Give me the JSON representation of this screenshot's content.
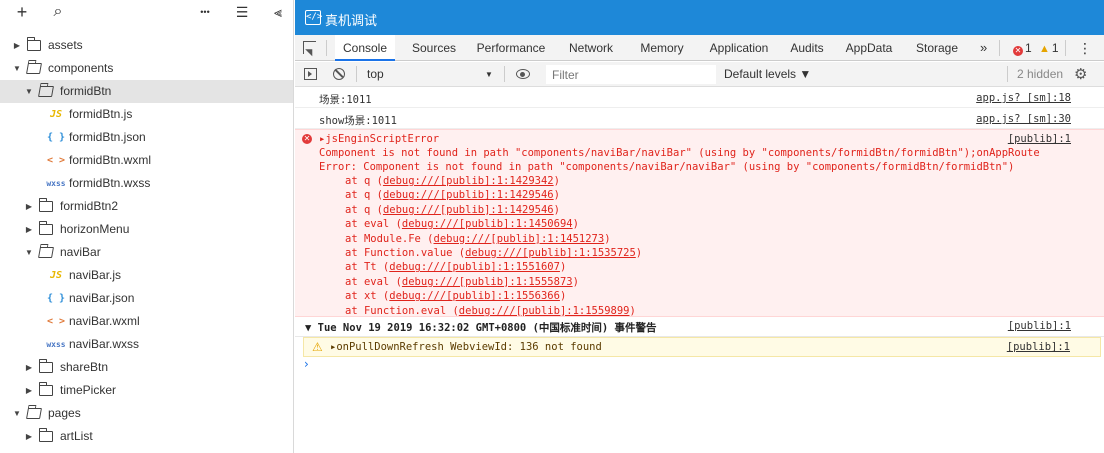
{
  "explorer": {
    "toolbar": {
      "add": "+",
      "search": "⌕",
      "more": "•••",
      "collapse": "☰",
      "split": "⫷"
    },
    "tree": [
      {
        "label": "assets",
        "type": "folder",
        "open": false,
        "depth": 0
      },
      {
        "label": "components",
        "type": "folder",
        "open": true,
        "depth": 0
      },
      {
        "label": "formidBtn",
        "type": "folder",
        "open": true,
        "depth": 1,
        "selected": true
      },
      {
        "label": "formidBtn.js",
        "type": "js",
        "icon": "JS",
        "depth": 2
      },
      {
        "label": "formidBtn.json",
        "type": "json",
        "icon": "{ }",
        "depth": 2
      },
      {
        "label": "formidBtn.wxml",
        "type": "wxml",
        "icon": "< >",
        "depth": 2
      },
      {
        "label": "formidBtn.wxss",
        "type": "wxss",
        "icon": "wxss",
        "depth": 2
      },
      {
        "label": "formidBtn2",
        "type": "folder",
        "open": false,
        "depth": 1
      },
      {
        "label": "horizonMenu",
        "type": "folder",
        "open": false,
        "depth": 1
      },
      {
        "label": "naviBar",
        "type": "folder",
        "open": true,
        "depth": 1
      },
      {
        "label": "naviBar.js",
        "type": "js",
        "icon": "JS",
        "depth": 2
      },
      {
        "label": "naviBar.json",
        "type": "json",
        "icon": "{ }",
        "depth": 2
      },
      {
        "label": "naviBar.wxml",
        "type": "wxml",
        "icon": "< >",
        "depth": 2
      },
      {
        "label": "naviBar.wxss",
        "type": "wxss",
        "icon": "wxss",
        "depth": 2
      },
      {
        "label": "shareBtn",
        "type": "folder",
        "open": false,
        "depth": 1
      },
      {
        "label": "timePicker",
        "type": "folder",
        "open": false,
        "depth": 1
      },
      {
        "label": "pages",
        "type": "folder",
        "open": true,
        "depth": 0
      },
      {
        "label": "artList",
        "type": "folder",
        "open": false,
        "depth": 1
      }
    ]
  },
  "devtools": {
    "title": "真机调试",
    "title_icon": "</>",
    "tabs": [
      {
        "label": "Console",
        "active": true
      },
      {
        "label": "Sources"
      },
      {
        "label": "Performance"
      },
      {
        "label": "Network"
      },
      {
        "label": "Memory"
      },
      {
        "label": "Application"
      },
      {
        "label": "Audits"
      },
      {
        "label": "AppData"
      },
      {
        "label": "Storage"
      }
    ],
    "more_tabs": "»",
    "error_count": "1",
    "warning_count": "1",
    "menu": "⋮",
    "filter_bar": {
      "context": "top",
      "context_arrow": "▼",
      "filter_placeholder": "Filter",
      "levels": "Default levels ▼",
      "hidden": "2 hidden",
      "settings": "⚙"
    },
    "console": {
      "logs": [
        {
          "text": "场景:1011",
          "source": "app.js? [sm]:18"
        },
        {
          "text": "show场景:1011",
          "source": "app.js? [sm]:30"
        }
      ],
      "error": {
        "title": "▸jsEnginScriptError",
        "source": "[publib]:1",
        "message": "Component is not found in path \"components/naviBar/naviBar\" (using by \"components/formidBtn/formidBtn\");onAppRoute",
        "error_line": "Error: Component is not found in path \"components/naviBar/naviBar\" (using by \"components/formidBtn/formidBtn\")",
        "stack": [
          {
            "fn": "at q (",
            "link": "debug:///[publib]:1:1429342",
            "end": ")"
          },
          {
            "fn": "at q (",
            "link": "debug:///[publib]:1:1429546",
            "end": ")"
          },
          {
            "fn": "at q (",
            "link": "debug:///[publib]:1:1429546",
            "end": ")"
          },
          {
            "fn": "at eval (",
            "link": "debug:///[publib]:1:1450694",
            "end": ")"
          },
          {
            "fn": "at Module.Fe (",
            "link": "debug:///[publib]:1:1451273",
            "end": ")"
          },
          {
            "fn": "at Function.value (",
            "link": "debug:///[publib]:1:1535725",
            "end": ")"
          },
          {
            "fn": "at Tt (",
            "link": "debug:///[publib]:1:1551607",
            "end": ")"
          },
          {
            "fn": "at eval (",
            "link": "debug:///[publib]:1:1555873",
            "end": ")"
          },
          {
            "fn": "at xt (",
            "link": "debug:///[publib]:1:1556366",
            "end": ")"
          },
          {
            "fn": "at Function.eval (",
            "link": "debug:///[publib]:1:1559899",
            "end": ")"
          }
        ]
      },
      "group": {
        "text": "▼ Tue Nov 19 2019 16:32:02 GMT+0800 (中国标准时间) 事件警告",
        "source": "[publib]:1"
      },
      "warning": {
        "text": "▸onPullDownRefresh WebviewId: 136 not found",
        "source": "[publib]:1"
      },
      "prompt": "›"
    }
  }
}
